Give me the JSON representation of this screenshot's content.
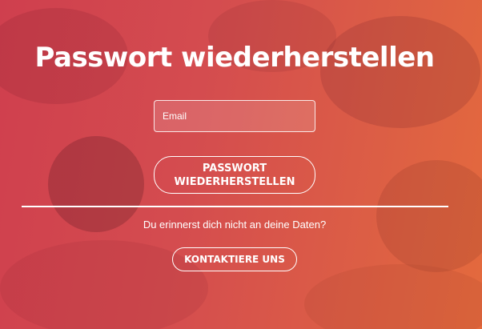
{
  "page": {
    "title": "Passwort wiederherstellen"
  },
  "form": {
    "email_placeholder": "Email",
    "email_value": "",
    "submit_label": "PASSWORT WIEDERHERSTELLEN"
  },
  "help": {
    "text": "Du erinnerst dich nicht an deine Daten?",
    "contact_label": "KONTAKTIERE UNS"
  },
  "colors": {
    "background_start": "#cf3f4e",
    "background_end": "#e46a3d",
    "foreground": "#ffffff"
  }
}
